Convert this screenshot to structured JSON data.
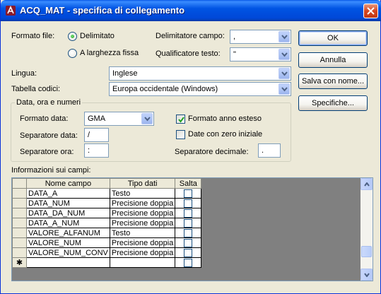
{
  "window": {
    "title": "ACQ_MAT - specifica di collegamento"
  },
  "file_format": {
    "label": "Formato file:",
    "options": [
      {
        "label": "Delimitato",
        "selected": true
      },
      {
        "label": "A larghezza fissa",
        "selected": false
      }
    ]
  },
  "delimiter": {
    "label": "Delimitatore campo:",
    "value": ","
  },
  "text_qualifier": {
    "label": "Qualificatore testo:",
    "value": "\""
  },
  "language": {
    "label": "Lingua:",
    "value": "Inglese"
  },
  "code_page": {
    "label": "Tabella codici:",
    "value": "Europa occidentale (Windows)"
  },
  "datetime_group": {
    "title": "Data, ora e numeri",
    "date_format": {
      "label": "Formato data:",
      "value": "GMA"
    },
    "date_separator": {
      "label": "Separatore data:",
      "value": "/"
    },
    "time_separator": {
      "label": "Separatore ora:",
      "value": ":"
    },
    "four_digit_year": {
      "label": "Formato anno esteso",
      "checked": true
    },
    "leading_zeros": {
      "label": "Date con zero iniziale",
      "checked": false
    },
    "decimal_separator": {
      "label": "Separatore decimale:",
      "value": "."
    }
  },
  "buttons": {
    "ok": "OK",
    "cancel": "Annulla",
    "save_as": "Salva con nome...",
    "specs": "Specifiche..."
  },
  "field_info": {
    "label": "Informazioni sui campi:",
    "columns": [
      "Nome campo",
      "Tipo dati",
      "Salta"
    ],
    "rows": [
      {
        "name": "DATA_A",
        "type": "Testo",
        "skip": false
      },
      {
        "name": "DATA_NUM",
        "type": "Precisione doppia",
        "skip": false
      },
      {
        "name": "DATA_DA_NUM",
        "type": "Precisione doppia",
        "skip": false
      },
      {
        "name": "DATA_A_NUM",
        "type": "Precisione doppia",
        "skip": false
      },
      {
        "name": "VALORE_ALFANUM",
        "type": "Testo",
        "skip": false
      },
      {
        "name": "VALORE_NUM",
        "type": "Precisione doppia",
        "skip": false
      },
      {
        "name": "VALORE_NUM_CONV",
        "type": "Precisione doppia",
        "skip": false
      }
    ],
    "new_row_marker": "✱"
  }
}
